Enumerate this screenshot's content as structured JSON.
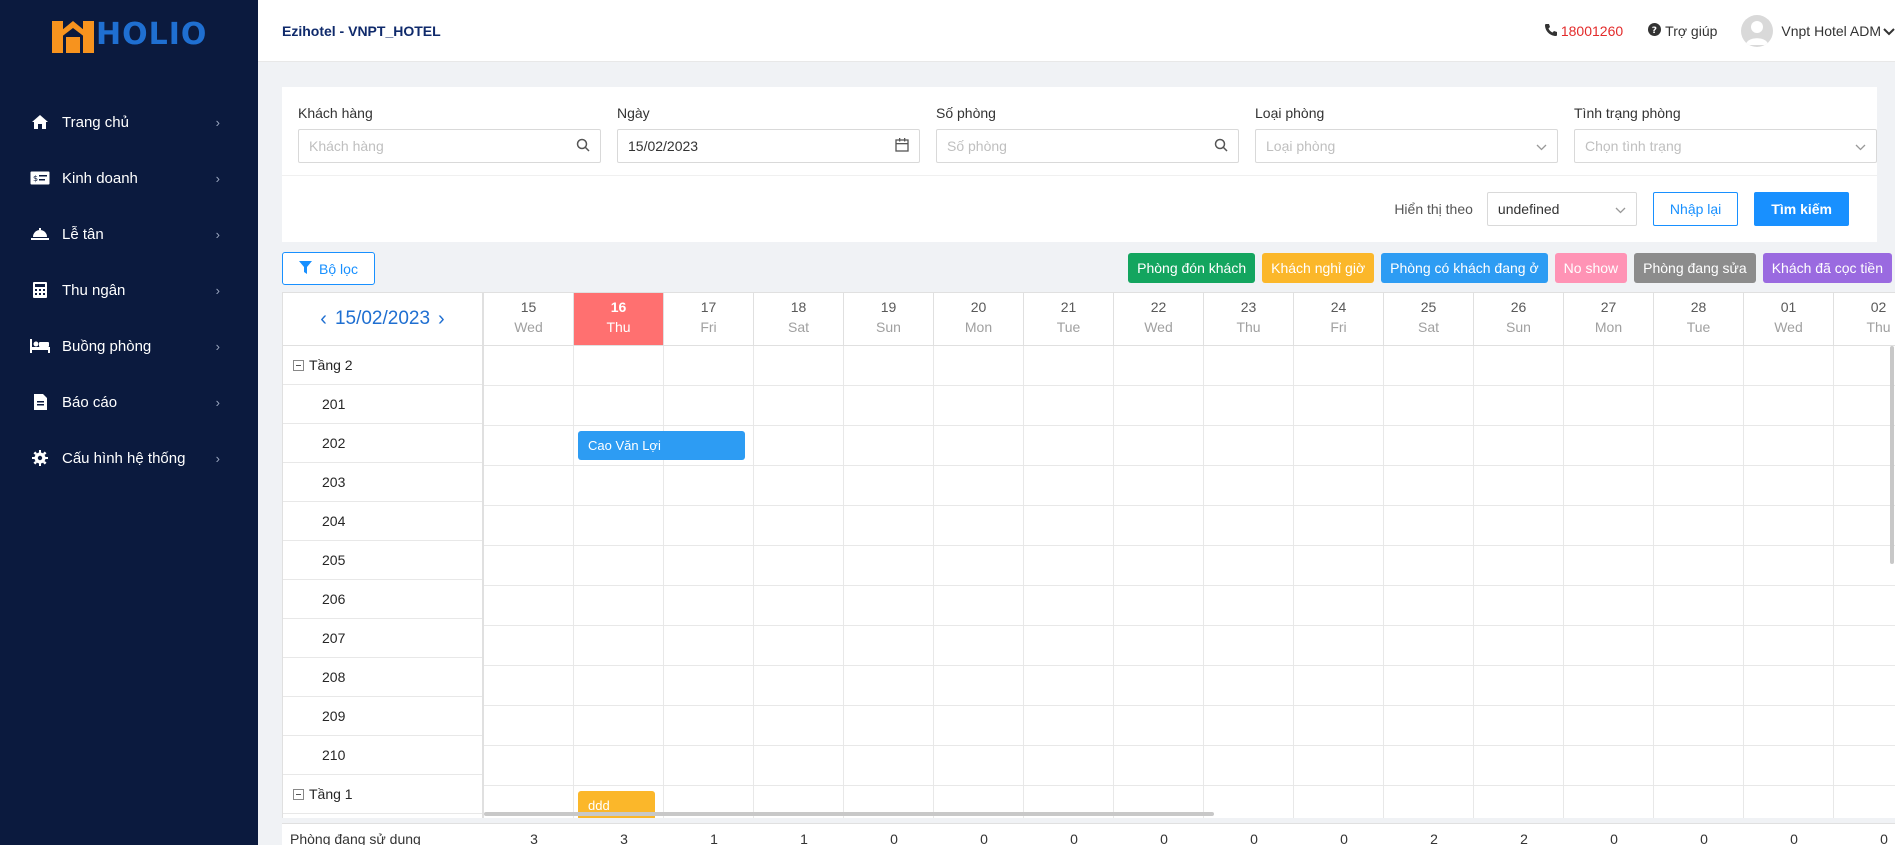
{
  "app": {
    "logo_text": "HOLIO"
  },
  "sidebar": {
    "items": [
      {
        "label": "Trang chủ",
        "icon": "home-icon"
      },
      {
        "label": "Kinh doanh",
        "icon": "ticket-icon"
      },
      {
        "label": "Lễ tân",
        "icon": "reception-bell-icon"
      },
      {
        "label": "Thu ngân",
        "icon": "calculator-icon"
      },
      {
        "label": "Buồng phòng",
        "icon": "bed-icon"
      },
      {
        "label": "Báo cáo",
        "icon": "report-icon"
      },
      {
        "label": "Cấu hình hệ thống",
        "icon": "gear-icon"
      }
    ]
  },
  "header": {
    "brand": "Ezihotel - VNPT_HOTEL",
    "hotline": "18001260",
    "help": "Trợ giúp",
    "user": "Vnpt Hotel ADM"
  },
  "filter": {
    "customer_label": "Khách hàng",
    "customer_placeholder": "Khách hàng",
    "date_label": "Ngày",
    "date_value": "15/02/2023",
    "room_label": "Số phòng",
    "room_placeholder": "Số phòng",
    "room_type_label": "Loại phòng",
    "room_type_placeholder": "Loại phòng",
    "status_label": "Tình trạng phòng",
    "status_placeholder": "Chọn tình trạng",
    "display_label": "Hiển thị theo",
    "display_value": "undefined",
    "reset_label": "Nhập lại",
    "search_label": "Tìm kiếm"
  },
  "toolbar": {
    "filter_label": "Bộ lọc",
    "legend": [
      {
        "label": "Phòng đón khách",
        "color": "#13a55f"
      },
      {
        "label": "Khách nghỉ giờ",
        "color": "#fbb72a"
      },
      {
        "label": "Phòng có khách đang ở",
        "color": "#2d9cf3"
      },
      {
        "label": "No show",
        "color": "#ff93b5"
      },
      {
        "label": "Phòng đang sửa",
        "color": "#8c8c8c"
      },
      {
        "label": "Khách đã cọc tiền",
        "color": "#9a6ae0"
      }
    ]
  },
  "calendar": {
    "current_date": "15/02/2023",
    "days": [
      {
        "num": "15",
        "dow": "Wed"
      },
      {
        "num": "16",
        "dow": "Thu"
      },
      {
        "num": "17",
        "dow": "Fri"
      },
      {
        "num": "18",
        "dow": "Sat"
      },
      {
        "num": "19",
        "dow": "Sun"
      },
      {
        "num": "20",
        "dow": "Mon"
      },
      {
        "num": "21",
        "dow": "Tue"
      },
      {
        "num": "22",
        "dow": "Wed"
      },
      {
        "num": "23",
        "dow": "Thu"
      },
      {
        "num": "24",
        "dow": "Fri"
      },
      {
        "num": "25",
        "dow": "Sat"
      },
      {
        "num": "26",
        "dow": "Sun"
      },
      {
        "num": "27",
        "dow": "Mon"
      },
      {
        "num": "28",
        "dow": "Tue"
      },
      {
        "num": "01",
        "dow": "Wed"
      },
      {
        "num": "02",
        "dow": "Thu"
      }
    ],
    "rows": [
      {
        "type": "group",
        "label": "Tầng 2"
      },
      {
        "type": "room",
        "label": "201"
      },
      {
        "type": "room",
        "label": "202"
      },
      {
        "type": "room",
        "label": "203"
      },
      {
        "type": "room",
        "label": "204"
      },
      {
        "type": "room",
        "label": "205"
      },
      {
        "type": "room",
        "label": "206"
      },
      {
        "type": "room",
        "label": "207"
      },
      {
        "type": "room",
        "label": "208"
      },
      {
        "type": "room",
        "label": "209"
      },
      {
        "type": "room",
        "label": "210"
      },
      {
        "type": "group",
        "label": "Tầng 1"
      }
    ],
    "bookings": [
      {
        "label": "Cao Văn Lợi",
        "row": 2,
        "day_start": 1,
        "day_span": 1.9,
        "color": "#2d9cf3"
      },
      {
        "label": "ddd",
        "row": 11,
        "day_start": 1,
        "day_span": 0.9,
        "color": "#fbb72a"
      }
    ]
  },
  "occupancy": {
    "label": "Phòng đang sử dụng",
    "values": [
      "3",
      "3",
      "1",
      "1",
      "0",
      "0",
      "0",
      "0",
      "0",
      "0",
      "2",
      "2",
      "0",
      "0",
      "0",
      "0"
    ]
  }
}
